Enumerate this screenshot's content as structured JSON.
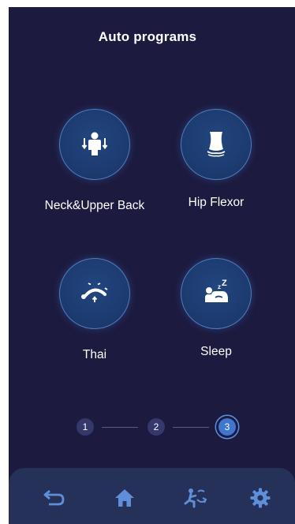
{
  "header": {
    "title": "Auto programs"
  },
  "programs": [
    {
      "label": "Neck&Upper Back",
      "icon": "neck-upper-back-icon"
    },
    {
      "label": "Hip Flexor",
      "icon": "hip-flexor-icon"
    },
    {
      "label": "Thai",
      "icon": "thai-stretch-icon"
    },
    {
      "label": "Sleep",
      "icon": "sleep-icon"
    }
  ],
  "pagination": {
    "steps": [
      "1",
      "2",
      "3"
    ],
    "active": 3
  },
  "bottom_nav": [
    {
      "icon": "back-arrow-icon"
    },
    {
      "icon": "home-icon"
    },
    {
      "icon": "massage-icon"
    },
    {
      "icon": "settings-gear-icon"
    }
  ],
  "colors": {
    "background": "#1c1a3f",
    "accent": "#3f77d0",
    "icon": "#5e8fd8"
  }
}
